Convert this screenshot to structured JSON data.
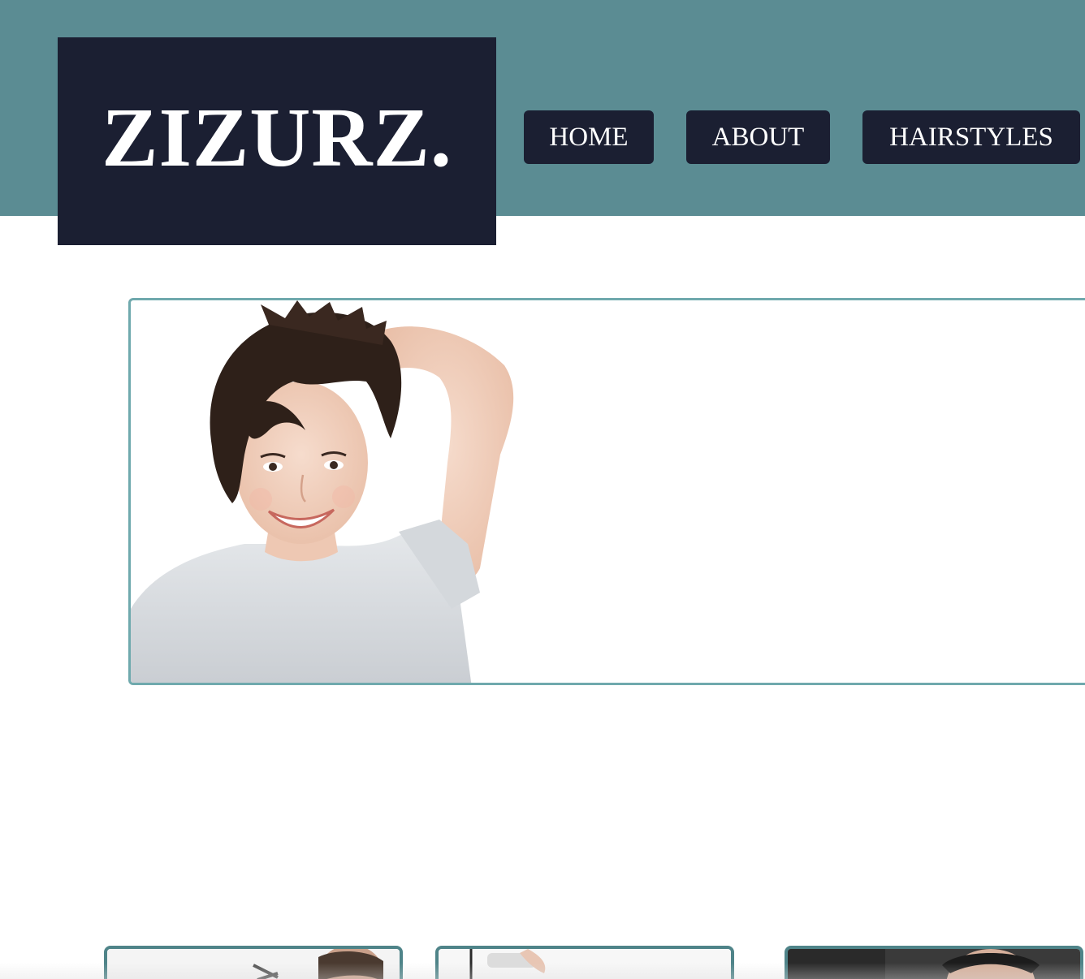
{
  "header": {
    "logo_text": "ZIZURZ.",
    "band_color": "#5b8c93",
    "dark_color": "#1b1f32"
  },
  "nav": {
    "home_label": "HOME",
    "about_label": "ABOUT",
    "hairstyles_label": "HAIRSTYLES"
  },
  "hero": {
    "image_subject": "smiling woman with short dark pixie haircut",
    "frame_color": "#6fa9ad"
  },
  "thumbnails": [
    {
      "subject": "stylist cutting hair with scissors"
    },
    {
      "subject": "hair clipper trimming"
    },
    {
      "subject": "man getting haircut"
    }
  ]
}
